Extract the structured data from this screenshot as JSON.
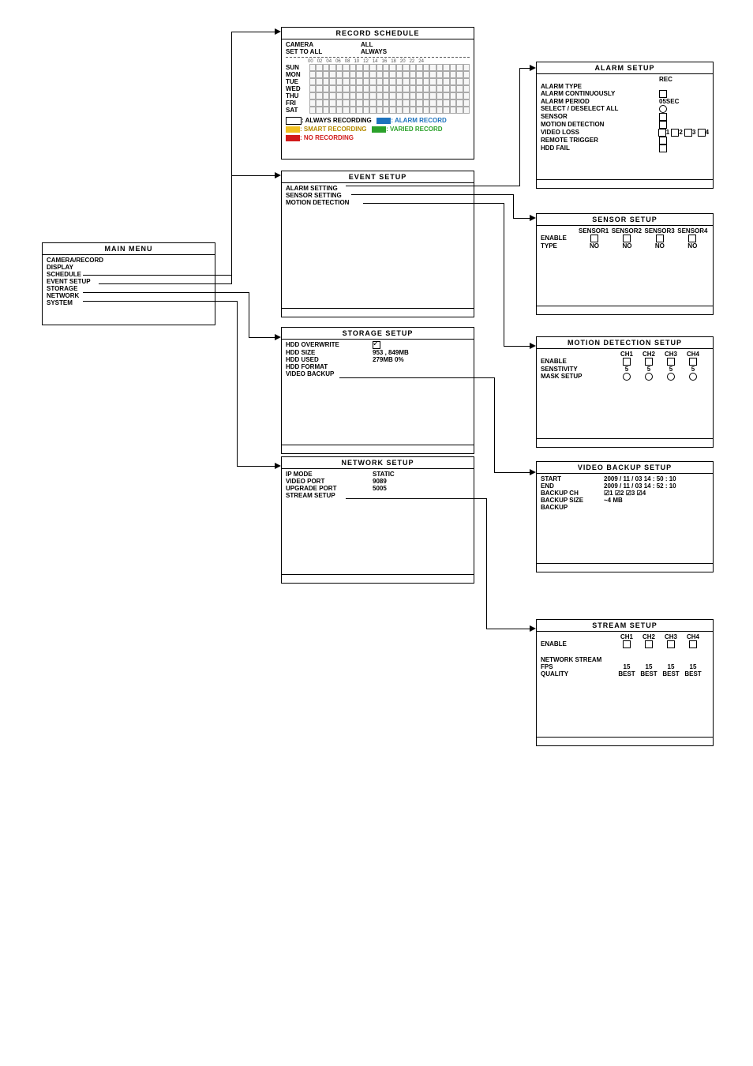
{
  "main_menu": {
    "title": "MAIN MENU",
    "items": [
      "CAMERA/RECORD",
      "DISPLAY",
      "SCHEDULE",
      "EVENT SETUP",
      "STORAGE",
      "NETWORK",
      "SYSTEM"
    ]
  },
  "record_schedule": {
    "title": "RECORD  SCHEDULE",
    "camera_label": "CAMERA",
    "camera_value": "ALL",
    "settoall_label": "SET TO ALL",
    "settoall_value": "ALWAYS",
    "hours": [
      "00",
      "02",
      "04",
      "06",
      "08",
      "10",
      "12",
      "14",
      "16",
      "18",
      "20",
      "22",
      "24"
    ],
    "days": [
      "SUN",
      "MON",
      "TUE",
      "WED",
      "THU",
      "FRI",
      "SAT"
    ],
    "legend": {
      "always": ": ALWAYS RECORDING",
      "alarm": ": ALARM RECORD",
      "smart": ": SMART RECORDING",
      "varied": ": VARIED RECORD",
      "no": ": NO RECORDING"
    }
  },
  "event_setup": {
    "title": "EVENT SETUP",
    "items": [
      "ALARM  SETTING",
      "SENSOR SETTING",
      "MOTION DETECTION"
    ]
  },
  "storage_setup": {
    "title": "STORAGE SETUP",
    "rows": {
      "overwrite": {
        "label": "HDD OVERWRITE",
        "value": "☑"
      },
      "size": {
        "label": "HDD SIZE",
        "value": "953 , 849MB"
      },
      "used": {
        "label": "HDD USED",
        "value": "279MB     0%"
      },
      "format": {
        "label": "HDD FORMAT",
        "value": ""
      },
      "backup": {
        "label": "VIDEO BACKUP",
        "value": ""
      }
    }
  },
  "network_setup": {
    "title": "NETWORK SETUP",
    "rows": {
      "ip": {
        "label": "IP MODE",
        "value": "STATIC"
      },
      "vport": {
        "label": "VIDEO PORT",
        "value": "9089"
      },
      "uport": {
        "label": "UPGRADE PORT",
        "value": "5005"
      },
      "stream": {
        "label": "STREAM SETUP",
        "value": ""
      }
    }
  },
  "alarm_setup": {
    "title": "ALARM  SETUP",
    "hdr_right": "REC",
    "rows": {
      "type": {
        "label": "ALARM TYPE"
      },
      "cont": {
        "label": "ALARM CONTINUOUSLY"
      },
      "period": {
        "label": "ALARM PERIOD",
        "value": "05SEC"
      },
      "select": {
        "label": "SELECT / DESELECT ALL"
      },
      "sensor": {
        "label": "SENSOR"
      },
      "motion": {
        "label": "MOTION DETECTION"
      },
      "vloss": {
        "label": "VIDEO LOSS",
        "extra": [
          "1",
          "2",
          "3",
          "4"
        ]
      },
      "rtrig": {
        "label": "REMOTE TRIGGER"
      },
      "hdd": {
        "label": "HDD FAIL"
      }
    }
  },
  "sensor_setup": {
    "title": "SENSOR  SETUP",
    "cols": [
      "SENSOR1",
      "SENSOR2",
      "SENSOR3",
      "SENSOR4"
    ],
    "enable_label": "ENABLE",
    "type_label": "TYPE",
    "type_val": "NO"
  },
  "motion_setup": {
    "title": "MOTION DETECTION SETUP",
    "cols": [
      "CH1",
      "CH2",
      "CH3",
      "CH4"
    ],
    "enable_label": "ENABLE",
    "sens_label": "SENSTIVITY",
    "sens_val": "5",
    "mask_label": "MASK SETUP"
  },
  "video_backup": {
    "title": "VIDEO BACKUP SETUP",
    "rows": {
      "start": {
        "label": "START",
        "value": "2009 / 11 / 03  14 : 50 : 10"
      },
      "end": {
        "label": "END",
        "value": "2009 / 11 / 03  14 : 52 : 10"
      },
      "ch": {
        "label": "BACKUP CH",
        "value": "☑1 ☑2 ☑3 ☑4"
      },
      "size": {
        "label": "BACKUP SIZE",
        "value": "~4  MB"
      },
      "bk": {
        "label": "BACKUP",
        "value": ""
      }
    }
  },
  "stream_setup": {
    "title": "STREAM  SETUP",
    "cols": [
      "CH1",
      "CH2",
      "CH3",
      "CH4"
    ],
    "enable": "ENABLE",
    "net": "NETWORK STREAM",
    "fps_label": "FPS",
    "fps_val": "15",
    "q_label": "QUALITY",
    "q_val": "BEST"
  }
}
